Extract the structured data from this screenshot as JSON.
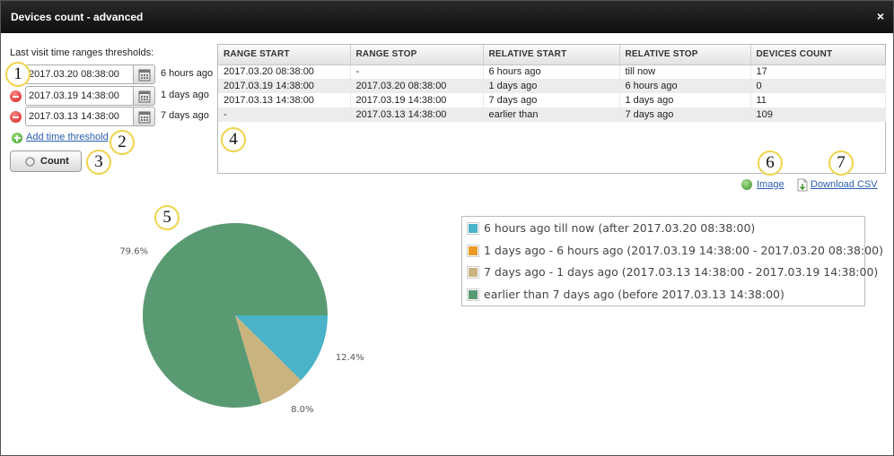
{
  "window": {
    "title": "Devices count - advanced",
    "close_glyph": "×"
  },
  "thresholds": {
    "label": "Last visit time ranges thresholds:",
    "rows": [
      {
        "value": "2017.03.20 08:38:00",
        "relative": "6 hours ago"
      },
      {
        "value": "2017.03.19 14:38:00",
        "relative": "1 days ago"
      },
      {
        "value": "2017.03.13 14:38:00",
        "relative": "7 days ago"
      }
    ],
    "add_label": "Add time threshold",
    "count_label": "Count"
  },
  "grid": {
    "columns": [
      "RANGE START",
      "RANGE STOP",
      "RELATIVE START",
      "RELATIVE STOP",
      "DEVICES COUNT"
    ],
    "rows": [
      [
        "2017.03.20 08:38:00",
        "-",
        "6 hours ago",
        "till now",
        "17"
      ],
      [
        "2017.03.19 14:38:00",
        "2017.03.20 08:38:00",
        "1 days ago",
        "6 hours ago",
        "0"
      ],
      [
        "2017.03.13 14:38:00",
        "2017.03.19 14:38:00",
        "7 days ago",
        "1 days ago",
        "11"
      ],
      [
        "-",
        "2017.03.13 14:38:00",
        "earlier than",
        "7 days ago",
        "109"
      ]
    ]
  },
  "actions": {
    "image_label": "Image",
    "csv_label": "Download CSV"
  },
  "badges": [
    "1",
    "2",
    "3",
    "4",
    "5",
    "6",
    "7"
  ],
  "chart_data": {
    "type": "pie",
    "slices": [
      {
        "label": "6 hours ago till now (after 2017.03.20 08:38:00)",
        "value": 17,
        "percent_label": "12.4%",
        "color": "#4bb3c8"
      },
      {
        "label": "1 days ago - 6 hours ago (2017.03.19 14:38:00 - 2017.03.20 08:38:00)",
        "value": 0,
        "percent_label": "",
        "color": "#eb9a22"
      },
      {
        "label": "7 days ago - 1 days ago (2017.03.13 14:38:00 - 2017.03.19 14:38:00)",
        "value": 11,
        "percent_label": "8.0%",
        "color": "#c9b37e"
      },
      {
        "label": "earlier than 7 days ago (before 2017.03.13 14:38:00)",
        "value": 109,
        "percent_label": "79.6%",
        "color": "#5a9a73"
      }
    ],
    "legend_position": "right"
  }
}
